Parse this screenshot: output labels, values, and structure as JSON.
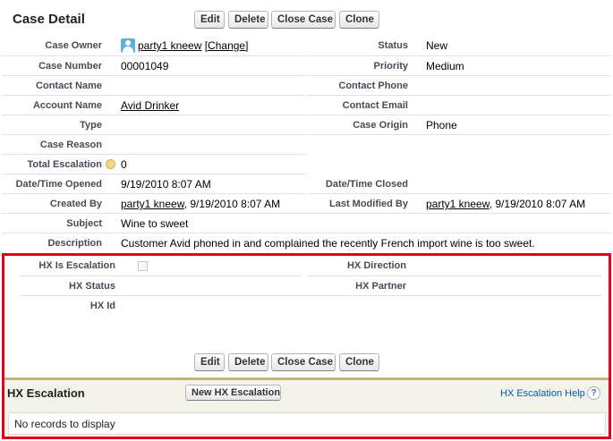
{
  "detail": {
    "title": "Case Detail",
    "buttons": {
      "edit": "Edit",
      "delete": "Delete",
      "close": "Close Case",
      "clone": "Clone"
    },
    "fields": {
      "case_owner_label": "Case Owner",
      "case_owner_value": "party1 kneew",
      "change_link": "[Change]",
      "status_label": "Status",
      "status_value": "New",
      "case_number_label": "Case Number",
      "case_number_value": "00001049",
      "priority_label": "Priority",
      "priority_value": "Medium",
      "contact_name_label": "Contact Name",
      "contact_phone_label": "Contact Phone",
      "account_name_label": "Account Name",
      "account_name_value": "Avid Drinker",
      "contact_email_label": "Contact Email",
      "type_label": "Type",
      "case_origin_label": "Case Origin",
      "case_origin_value": "Phone",
      "case_reason_label": "Case Reason",
      "total_escalation_label": "Total Escalation",
      "total_escalation_value": "0",
      "opened_label": "Date/Time Opened",
      "opened_value": "9/19/2010 8:07 AM",
      "closed_label": "Date/Time Closed",
      "created_by_label": "Created By",
      "created_by_user": "party1 kneew",
      "created_by_date": ", 9/19/2010 8:07 AM",
      "modified_by_label": "Last Modified By",
      "modified_by_user": "party1 kneew",
      "modified_by_date": ", 9/19/2010 8:07 AM",
      "subject_label": "Subject",
      "subject_value": "Wine to sweet",
      "description_label": "Description",
      "description_value": "Customer Avid phoned in and complained the recently French import wine is too sweet."
    },
    "hx": {
      "is_escalation_label": "HX Is Escalation",
      "direction_label": "HX Direction",
      "status_label": "HX Status",
      "partner_label": "HX Partner",
      "id_label": "HX Id"
    }
  },
  "related": {
    "title": "HX Escalation",
    "new_button": "New HX Escalation",
    "help_link": "HX Escalation Help",
    "help_icon": "?",
    "empty_text": "No records to display"
  }
}
